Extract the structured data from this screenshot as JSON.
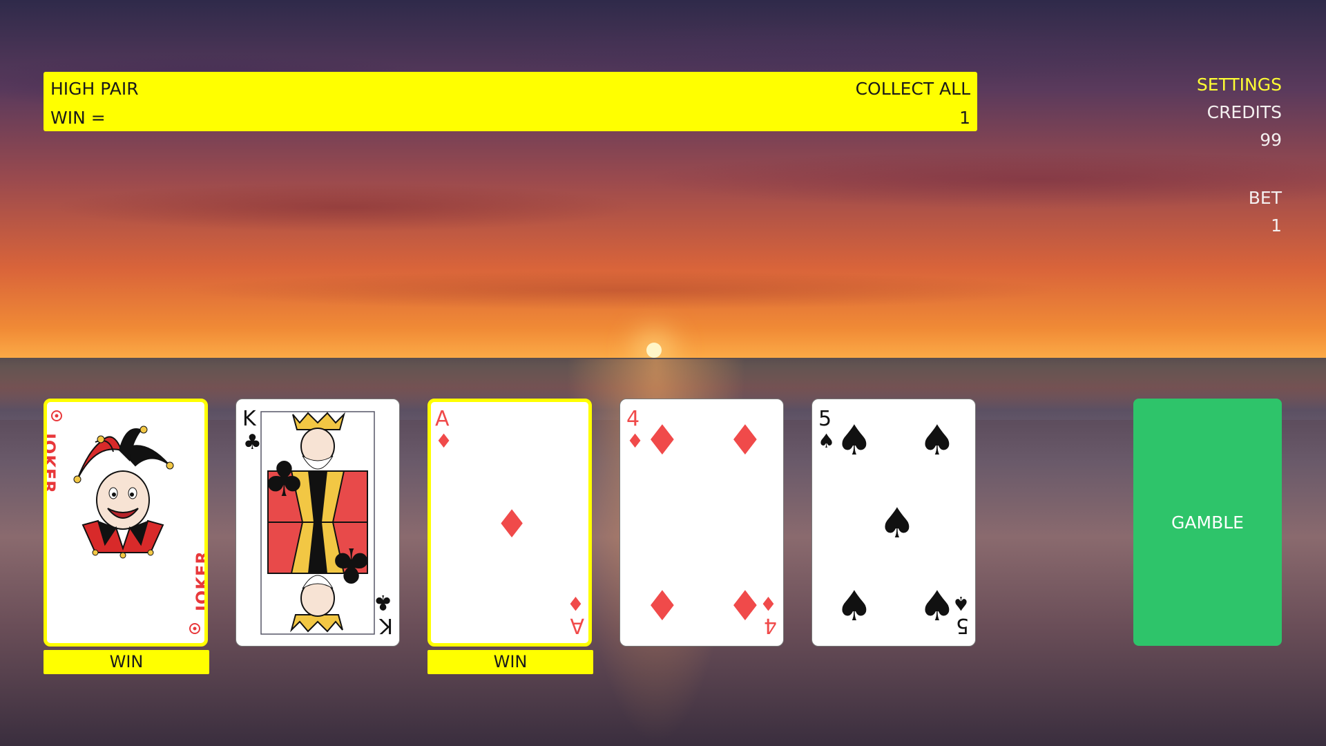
{
  "banner": {
    "hand_name": "HIGH PAIR",
    "collect_label": "COLLECT ALL",
    "win_label": "WIN =",
    "win_amount": "1"
  },
  "panel": {
    "settings_label": "SETTINGS",
    "credits_label": "CREDITS",
    "credits_value": "99",
    "bet_label": "BET",
    "bet_value": "1"
  },
  "cards": [
    {
      "rank": "JOKER",
      "suit": "joker",
      "color": "#e8383b",
      "held": true,
      "win_label": "WIN"
    },
    {
      "rank": "K",
      "suit": "clubs",
      "color": "#111111",
      "held": false
    },
    {
      "rank": "A",
      "suit": "diamonds",
      "color": "#f04a4a",
      "held": true,
      "win_label": "WIN"
    },
    {
      "rank": "4",
      "suit": "diamonds",
      "color": "#f04a4a",
      "held": false
    },
    {
      "rank": "5",
      "suit": "spades",
      "color": "#111111",
      "held": false
    }
  ],
  "gamble_label": "GAMBLE",
  "colors": {
    "highlight": "#ffff00",
    "gamble": "#2ec46a"
  }
}
